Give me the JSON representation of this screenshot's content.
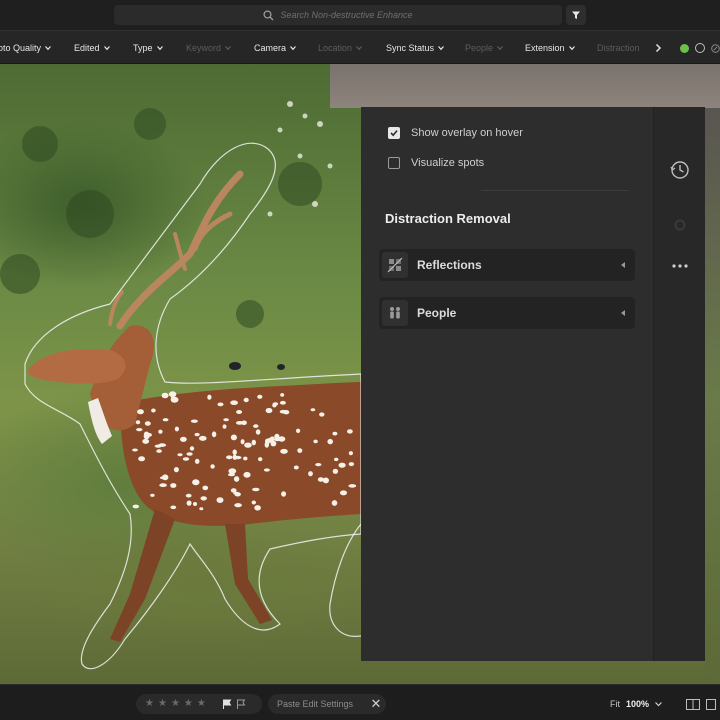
{
  "search": {
    "placeholder": "Search Non-destructive Enhance"
  },
  "filterbar": {
    "items": [
      {
        "label": "oto Quality",
        "dim": false
      },
      {
        "label": "Edited",
        "dim": false
      },
      {
        "label": "Type",
        "dim": false
      },
      {
        "label": "Keyword",
        "dim": true
      },
      {
        "label": "Camera",
        "dim": false
      },
      {
        "label": "Location",
        "dim": true
      },
      {
        "label": "Sync Status",
        "dim": false
      },
      {
        "label": "People",
        "dim": true
      },
      {
        "label": "Extension",
        "dim": false
      },
      {
        "label": "Distraction",
        "dim": true
      }
    ]
  },
  "panel": {
    "show_overlay_label": "Show overlay on hover",
    "show_overlay_checked": true,
    "visualize_spots_label": "Visualize spots",
    "visualize_spots_checked": false,
    "section_title": "Distraction Removal",
    "cards": [
      {
        "label": "Reflections",
        "icon": "reflections-icon"
      },
      {
        "label": "People",
        "icon": "people-icon"
      }
    ]
  },
  "iconcol": {
    "icons": [
      "history-icon",
      "settings-icon",
      "more-icon"
    ]
  },
  "bottombar": {
    "rating_max": 5,
    "rating": 0,
    "paste_label": "Paste Edit Settings",
    "fit_label": "Fit",
    "zoom_label": "100%"
  },
  "colors": {
    "accent_green": "#6cc04a",
    "panel_bg": "#2d2d2d"
  }
}
